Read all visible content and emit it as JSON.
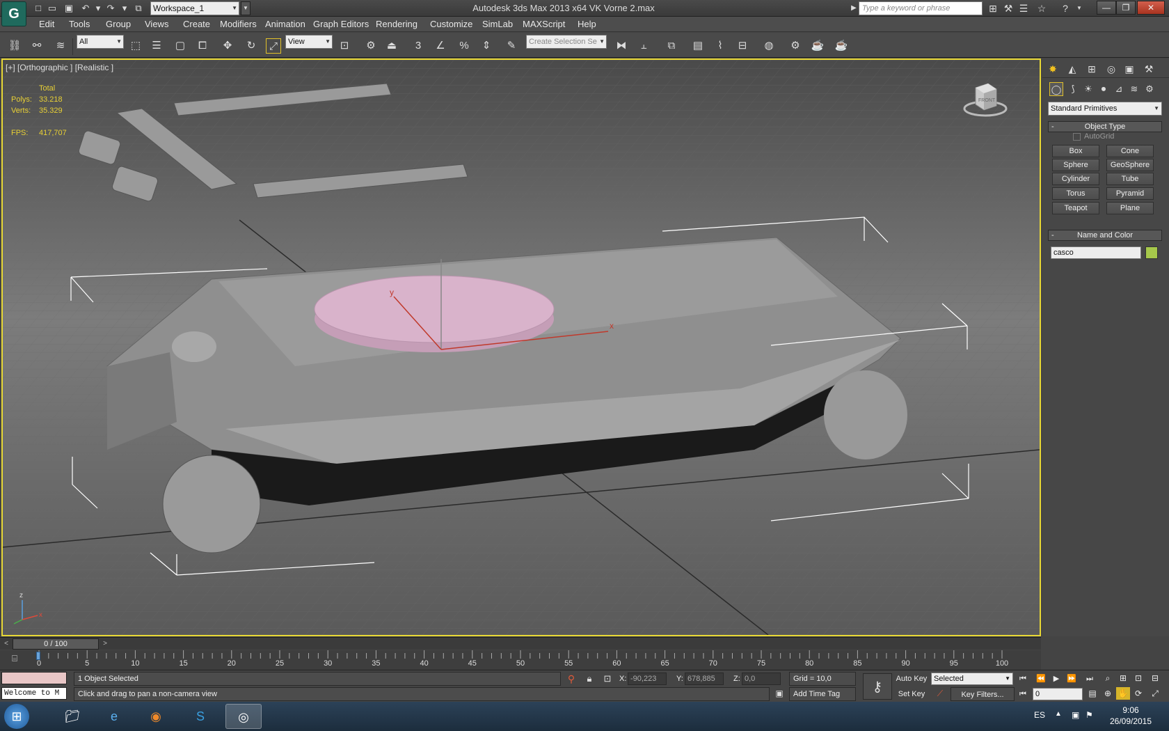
{
  "app": {
    "title": "Autodesk 3ds Max  2013 x64     VK  Vorne 2.max",
    "workspace": "Workspace_1",
    "search_placeholder": "Type a keyword or phrase",
    "logo_glyph": "G"
  },
  "menu": [
    "Edit",
    "Tools",
    "Group",
    "Views",
    "Create",
    "Modifiers",
    "Animation",
    "Graph Editors",
    "Rendering",
    "Customize",
    "SimLab",
    "MAXScript",
    "Help"
  ],
  "toolbar": {
    "selection_filter": "All",
    "reference_coord": "View",
    "named_selection_placeholder": "Create Selection Se",
    "snap_label": "3"
  },
  "viewport": {
    "label": "[+] [Orthographic ] [Realistic ]",
    "stats": {
      "header": "Total",
      "polys_label": "Polys:",
      "polys": "33.218",
      "verts_label": "Verts:",
      "verts": "35.329",
      "fps_label": "FPS:",
      "fps": "417,707"
    },
    "viewcube_label": "FRONT",
    "active_border_color": "#e8d835",
    "gizmo_x": "x",
    "gizmo_y": "y",
    "axis_z": "z",
    "axis_x": "x"
  },
  "command_panel": {
    "category": "Standard Primitives",
    "object_type_title": "Object Type",
    "autogrid": "AutoGrid",
    "primitives": [
      "Box",
      "Cone",
      "Sphere",
      "GeoSphere",
      "Cylinder",
      "Tube",
      "Torus",
      "Pyramid",
      "Teapot",
      "Plane"
    ],
    "name_color_title": "Name and Color",
    "object_name": "casco",
    "object_color": "#a6c84b"
  },
  "time_slider": {
    "label": "0 / 100",
    "ticks": [
      "0",
      "5",
      "10",
      "15",
      "20",
      "25",
      "30",
      "35",
      "40",
      "45",
      "50",
      "55",
      "60",
      "65",
      "70",
      "75",
      "80",
      "85",
      "90",
      "95",
      "100"
    ]
  },
  "status": {
    "welcome": "Welcome to M",
    "selection_info": "1 Object Selected",
    "prompt": "Click and drag to pan a non-camera view",
    "x_label": "X:",
    "x": "-90,223",
    "y_label": "Y:",
    "y": "678,885",
    "z_label": "Z:",
    "z": "0,0",
    "grid": "Grid = 10,0",
    "add_time_tag": "Add Time Tag",
    "auto_key": "Auto Key",
    "set_key": "Set Key",
    "key_mode": "Selected",
    "key_filters": "Key Filters...",
    "current_frame": "0"
  },
  "taskbar": {
    "language": "ES",
    "time": "9:06",
    "date": "26/09/2015"
  }
}
